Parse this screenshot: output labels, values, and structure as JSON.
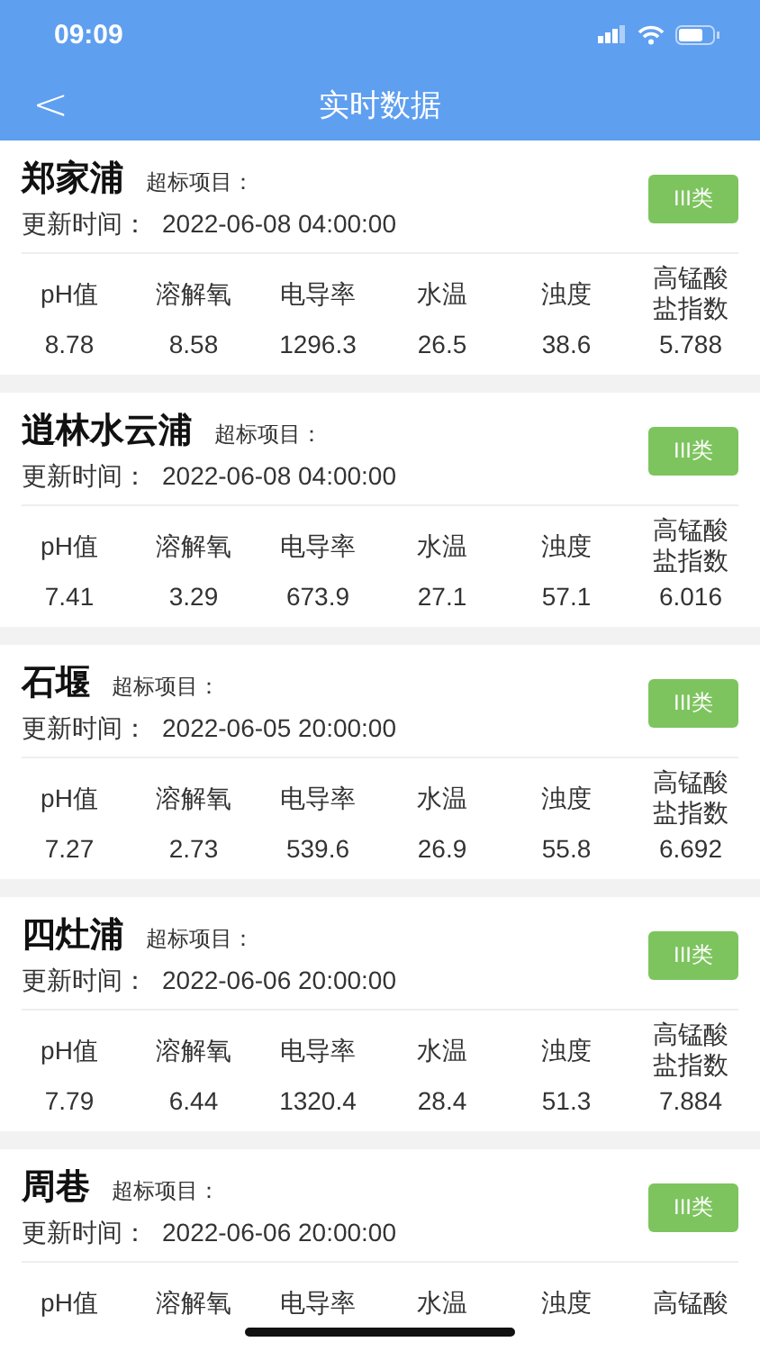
{
  "status_bar": {
    "time": "09:09"
  },
  "header": {
    "back": "<",
    "title": "实时数据"
  },
  "stations": [
    {
      "name": "郑家浦",
      "exceed_label": "超标项目：",
      "update_label": "更新时间：",
      "update_time": "2022-06-08 04:00:00",
      "grade": "III类",
      "columns": [
        "pH值",
        "溶解氧",
        "电导率",
        "水温",
        "浊度",
        "高锰酸盐指数"
      ],
      "values": [
        "8.78",
        "8.58",
        "1296.3",
        "26.5",
        "38.6",
        "5.788"
      ]
    },
    {
      "name": "逍林水云浦",
      "exceed_label": "超标项目：",
      "update_label": "更新时间：",
      "update_time": "2022-06-08 04:00:00",
      "grade": "III类",
      "columns": [
        "pH值",
        "溶解氧",
        "电导率",
        "水温",
        "浊度",
        "高锰酸盐指数"
      ],
      "values": [
        "7.41",
        "3.29",
        "673.9",
        "27.1",
        "57.1",
        "6.016"
      ]
    },
    {
      "name": "石堰",
      "exceed_label": "超标项目：",
      "update_label": "更新时间：",
      "update_time": "2022-06-05 20:00:00",
      "grade": "III类",
      "columns": [
        "pH值",
        "溶解氧",
        "电导率",
        "水温",
        "浊度",
        "高锰酸盐指数"
      ],
      "values": [
        "7.27",
        "2.73",
        "539.6",
        "26.9",
        "55.8",
        "6.692"
      ]
    },
    {
      "name": "四灶浦",
      "exceed_label": "超标项目：",
      "update_label": "更新时间：",
      "update_time": "2022-06-06 20:00:00",
      "grade": "III类",
      "columns": [
        "pH值",
        "溶解氧",
        "电导率",
        "水温",
        "浊度",
        "高锰酸盐指数"
      ],
      "values": [
        "7.79",
        "6.44",
        "1320.4",
        "28.4",
        "51.3",
        "7.884"
      ]
    },
    {
      "name": "周巷",
      "exceed_label": "超标项目：",
      "update_label": "更新时间：",
      "update_time": "2022-06-06 20:00:00",
      "grade": "III类",
      "columns": [
        "pH值",
        "溶解氧",
        "电导率",
        "水温",
        "浊度",
        "高锰酸"
      ]
    }
  ]
}
